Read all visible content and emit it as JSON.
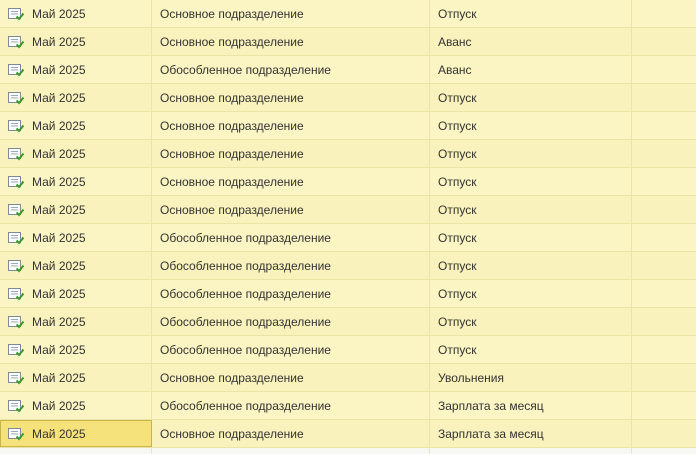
{
  "icon_name": "document-posted-icon",
  "colors": {
    "row_bg": "#fbf4c3",
    "selected_bg": "#f6e27a",
    "icon_green": "#3b9b2a"
  },
  "rows": [
    {
      "period": "Май 2025",
      "department": "Основное подразделение",
      "type": "Отпуск"
    },
    {
      "period": "Май 2025",
      "department": "Основное подразделение",
      "type": "Аванс"
    },
    {
      "period": "Май 2025",
      "department": "Обособленное подразделение",
      "type": "Аванс"
    },
    {
      "period": "Май 2025",
      "department": "Основное подразделение",
      "type": "Отпуск"
    },
    {
      "period": "Май 2025",
      "department": "Основное подразделение",
      "type": "Отпуск"
    },
    {
      "period": "Май 2025",
      "department": "Основное подразделение",
      "type": "Отпуск"
    },
    {
      "period": "Май 2025",
      "department": "Основное подразделение",
      "type": "Отпуск"
    },
    {
      "period": "Май 2025",
      "department": "Основное подразделение",
      "type": "Отпуск"
    },
    {
      "period": "Май 2025",
      "department": "Обособленное подразделение",
      "type": "Отпуск"
    },
    {
      "period": "Май 2025",
      "department": "Обособленное подразделение",
      "type": "Отпуск"
    },
    {
      "period": "Май 2025",
      "department": "Обособленное подразделение",
      "type": "Отпуск"
    },
    {
      "period": "Май 2025",
      "department": "Обособленное подразделение",
      "type": "Отпуск"
    },
    {
      "period": "Май 2025",
      "department": "Обособленное подразделение",
      "type": "Отпуск"
    },
    {
      "period": "Май 2025",
      "department": "Основное подразделение",
      "type": "Увольнения"
    },
    {
      "period": "Май 2025",
      "department": "Обособленное подразделение",
      "type": "Зарплата за месяц"
    },
    {
      "period": "Май 2025",
      "department": "Основное подразделение",
      "type": "Зарплата за месяц",
      "selected": true
    }
  ]
}
